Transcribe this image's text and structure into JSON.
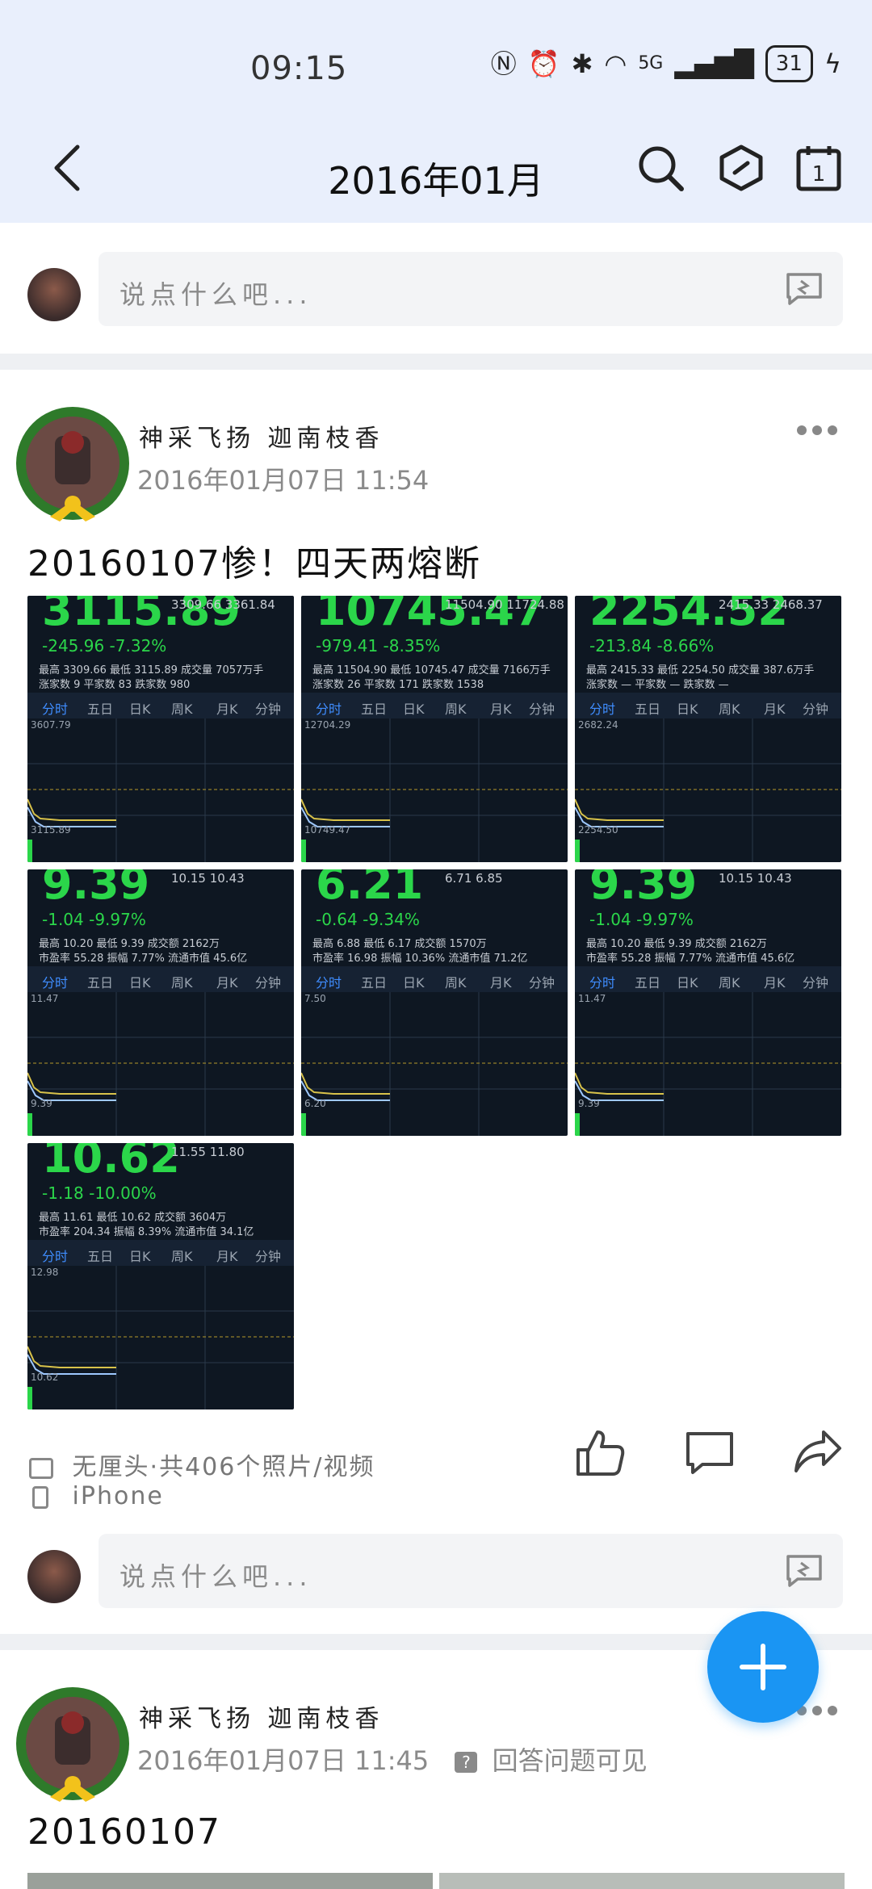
{
  "status_bar": {
    "time": "09:15",
    "battery": "31",
    "network": "5G"
  },
  "header": {
    "title": "2016年01月"
  },
  "comment_bar": {
    "placeholder": "说点什么吧..."
  },
  "posts": [
    {
      "author": "神采飞扬 迦南枝香",
      "time": "2016年01月07日 11:54",
      "text": "20160107惨！四天两熔断",
      "images": [
        {
          "big": "3115.89",
          "chg": "-245.96  -7.32%",
          "r1": "3309.66  3361.84",
          "r2": "最高 3309.66 最低 3115.89 成交量 7057万手",
          "r3": "涨家数 9  平家数 83  跌家数 980",
          "scale_top": "3607.79",
          "scale_low": "3115.89"
        },
        {
          "big": "10745.47",
          "chg": "-979.41  -8.35%",
          "r1": "11504.90  11724.88",
          "r2": "最高 11504.90 最低 10745.47 成交量 7166万手",
          "r3": "涨家数 26  平家数 171  跌家数 1538",
          "scale_top": "12704.29",
          "scale_low": "10749.47"
        },
        {
          "big": "2254.52",
          "chg": "-213.84  -8.66%",
          "r1": "2415.33  2468.37",
          "r2": "最高 2415.33 最低 2254.50 成交量 387.6万手",
          "r3": "涨家数 —  平家数 —  跌家数 —",
          "scale_top": "2682.24",
          "scale_low": "2254.50"
        },
        {
          "big": "9.39",
          "chg": "-1.04  -9.97%",
          "r1": "10.15  10.43",
          "r2": "最高 10.20 最低 9.39 成交额 2162万",
          "r3": "市盈率 55.28  振幅 7.77%  流通市值 45.6亿",
          "scale_top": "11.47",
          "scale_low": "9.39"
        },
        {
          "big": "6.21",
          "chg": "-0.64  -9.34%",
          "r1": "6.71  6.85",
          "r2": "最高 6.88 最低 6.17 成交额 1570万",
          "r3": "市盈率 16.98  振幅 10.36%  流通市值 71.2亿",
          "scale_top": "7.50",
          "scale_low": "6.20"
        },
        {
          "big": "9.39",
          "chg": "-1.04  -9.97%",
          "r1": "10.15  10.43",
          "r2": "最高 10.20 最低 9.39 成交额 2162万",
          "r3": "市盈率 55.28  振幅 7.77%  流通市值 45.6亿",
          "scale_top": "11.47",
          "scale_low": "9.39"
        },
        {
          "big": "10.62",
          "chg": "-1.18  -10.00%",
          "r1": "11.55  11.80",
          "r2": "最高 11.61 最低 10.62 成交额 3604万",
          "r3": "市盈率 204.34  振幅 8.39%  流通市值 34.1亿",
          "scale_top": "12.98",
          "scale_low": "10.62"
        }
      ],
      "tabs": [
        "分时",
        "五日",
        "日K",
        "周K",
        "月K",
        "分钟"
      ],
      "album": "无厘头·共406个照片/视频",
      "device": "iPhone"
    },
    {
      "author": "神采飞扬 迦南枝香",
      "time": "2016年01月07日 11:45",
      "qa": "回答问题可见",
      "text": "20160107"
    }
  ],
  "icons": {
    "back": "chevron-left-icon",
    "search": "search-icon",
    "hex": "hexagon-icon",
    "calendar": "calendar-icon",
    "comment": "message-icon",
    "like": "thumbs-up-icon",
    "reply": "comment-icon",
    "share": "share-icon",
    "fab": "plus-icon"
  },
  "colors": {
    "header_bg": "#e9effc",
    "fab": "#1a95f3",
    "stock_green": "#2bd64a"
  }
}
